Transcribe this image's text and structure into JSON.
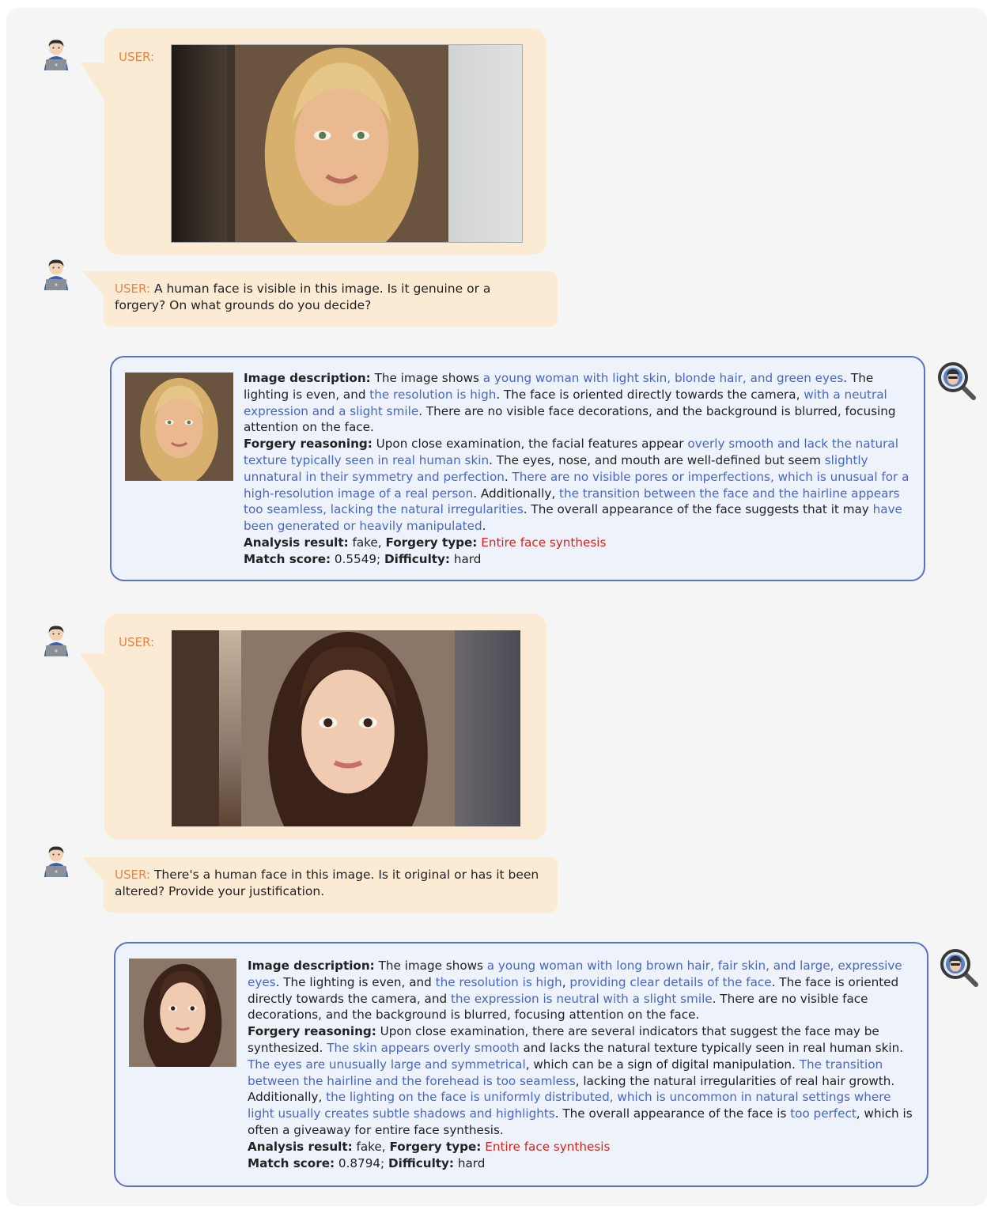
{
  "colors": {
    "user_tag": "#e8843f",
    "highlight": "#4866c3",
    "forgery_type": "#e0201b",
    "bubble": "#fcebd4",
    "answer_bg": "#edf2fb",
    "answer_border": "#5a73c0"
  },
  "icons": {
    "user_avatar": "person-with-laptop-icon",
    "assistant": "magnifier-detective-icon"
  },
  "user_label": "USER:",
  "conv1": {
    "question": "A human face is visible in this image. Is it genuine or a forgery? On what grounds do you decide?",
    "desc_label": "Image description:",
    "desc_parts": [
      "The image shows ",
      "a young woman with light skin, blonde hair, and green eyes",
      ". The lighting is even, and ",
      "the resolution is high",
      ". The face is oriented directly towards the camera, ",
      "with a neutral expression and a slight smile",
      ". There are no visible face decorations, and the background is blurred, focusing attention on the face."
    ],
    "reason_label": "Forgery reasoning:",
    "reason_parts": [
      "Upon close examination, the facial features appear ",
      "overly smooth and lack the natural texture typically seen in real human skin",
      ". The eyes, nose, and mouth are well-defined but seem ",
      "slightly unnatural in their symmetry and perfection",
      ". ",
      "There are no visible pores or imperfections, which is unusual for a high-resolution image of a real person",
      ". Additionally, ",
      "the transition between the face and the hairline appears too seamless, lacking the natural irregularities",
      ". The overall appearance of the face suggests that it may ",
      "have been generated or heavily manipulated",
      "."
    ],
    "result_label": "Analysis result:",
    "result_value": "fake,",
    "type_label": "Forgery type:",
    "type_value": "Entire face synthesis",
    "score_label": "Match score:",
    "score_value": "0.5549;",
    "difficulty_label": "Difficulty:",
    "difficulty_value": "hard"
  },
  "conv2": {
    "question": "There's a human face in this image. Is it original or has it been altered? Provide your justification.",
    "desc_label": "Image description:",
    "desc_parts": [
      "The image shows ",
      "a young woman with long brown hair, fair skin, and large, expressive eyes",
      ". The lighting is even, and ",
      "the resolution is high",
      ", ",
      "providing clear details of the face",
      ". The face is oriented directly towards the camera, and ",
      "the expression is neutral with a slight smile",
      ". There are no visible face decorations, and the background is blurred, focusing attention on the face."
    ],
    "reason_label": "Forgery reasoning:",
    "reason_parts": [
      "Upon close examination, there are several indicators that suggest the face may be synthesized. ",
      "The skin appears overly smooth",
      " and lacks the natural texture typically seen in real human skin. ",
      "The eyes are unusually large and symmetrical",
      ", which can be a sign of digital manipulation. ",
      "The transition between the hairline and the forehead is too seamless",
      ", lacking the natural irregularities of real hair growth. Additionally, ",
      "the lighting on the face is uniformly distributed, which is uncommon in natural settings where light usually creates subtle shadows and highlights",
      ". The overall appearance of the face is ",
      "too perfect",
      ", which is often a giveaway for entire face synthesis."
    ],
    "result_label": "Analysis result:",
    "result_value": "fake,",
    "type_label": "Forgery type:",
    "type_value": "Entire face synthesis",
    "score_label": "Match score:",
    "score_value": "0.8794;",
    "difficulty_label": "Difficulty:",
    "difficulty_value": "hard"
  }
}
